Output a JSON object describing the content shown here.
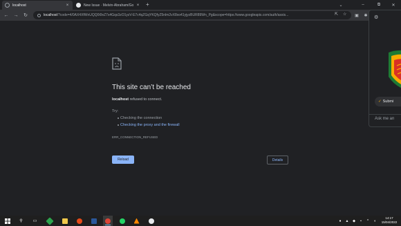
{
  "browser": {
    "tabs": [
      {
        "title": "localhost",
        "active": true,
        "close_icon": "×"
      },
      {
        "title": "New Issue · Melvin-Abraham/Go",
        "active": false,
        "close_icon": "×"
      }
    ],
    "new_tab_icon": "+",
    "window_controls": {
      "minimize": "–",
      "maximize": "⧉",
      "close": "✕"
    },
    "address_bar": {
      "host": "localhost",
      "rest": "/?code=4/0AX4XfWnUQQ0t9vZ7s4Gqs3zO1yzV-E7c4qZGqYKQfyZ5nlm2vX8xo41yjyzBUR89Wn_Pg&scope=https://www.googleapis.com/auth/assis..."
    },
    "colors": {
      "accent": "#8ab4f8",
      "background": "#202124"
    }
  },
  "error_page": {
    "title": "This site can’t be reached",
    "host": "localhost",
    "message": "refused to connect.",
    "try_label": "Try:",
    "suggestions": [
      "Checking the connection",
      "Checking the proxy and the firewall"
    ],
    "error_code": "ERR_CONNECTION_REFUSED",
    "reload_label": "Reload",
    "details_label": "Details"
  },
  "popup": {
    "submit_label": "Submi",
    "ask_label": "Ask me an"
  },
  "taskbar": {
    "time": "14:17",
    "date": "15/04/2022"
  }
}
